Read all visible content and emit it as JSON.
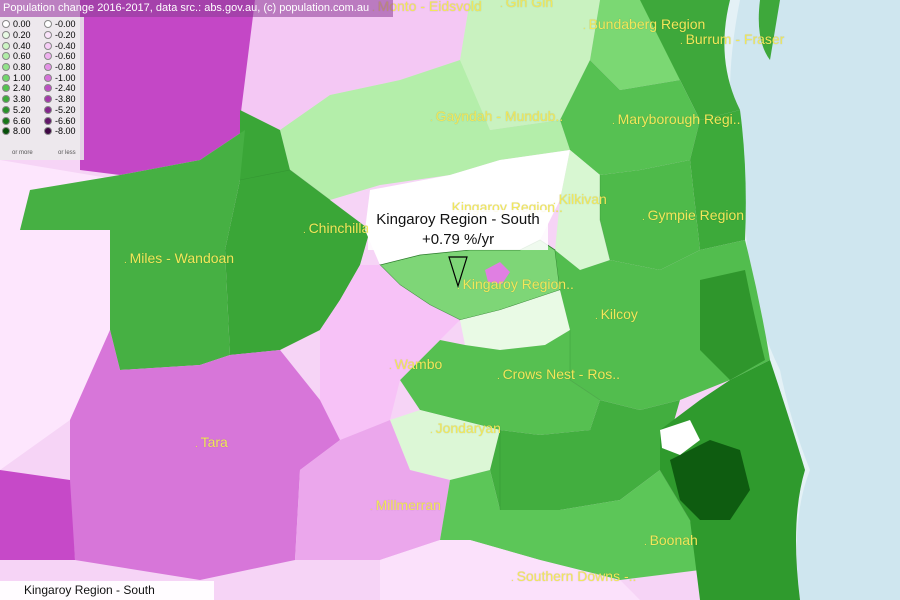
{
  "title": "Population change 2016-2017, data src.: abs.gov.au, (c) population.com.au",
  "legend": {
    "positive": [
      {
        "value": "0.00",
        "color": "#ffffff"
      },
      {
        "value": "0.20",
        "color": "#e8fbe4"
      },
      {
        "value": "0.40",
        "color": "#cdf5c4"
      },
      {
        "value": "0.60",
        "color": "#b1eda7"
      },
      {
        "value": "0.80",
        "color": "#93e38b"
      },
      {
        "value": "1.00",
        "color": "#72d66c"
      },
      {
        "value": "2.40",
        "color": "#53c24f"
      },
      {
        "value": "3.80",
        "color": "#3dab3b"
      },
      {
        "value": "5.20",
        "color": "#29922a"
      },
      {
        "value": "6.60",
        "color": "#177619"
      },
      {
        "value": "8.00",
        "color": "#064f09"
      }
    ],
    "negative": [
      {
        "value": "-0.00",
        "color": "#ffffff"
      },
      {
        "value": "-0.20",
        "color": "#fbe4fb"
      },
      {
        "value": "-0.40",
        "color": "#f6cdf6"
      },
      {
        "value": "-0.60",
        "color": "#efb1ef"
      },
      {
        "value": "-0.80",
        "color": "#e493e6"
      },
      {
        "value": "-1.00",
        "color": "#d572d8"
      },
      {
        "value": "-2.40",
        "color": "#bd50c2"
      },
      {
        "value": "-3.80",
        "color": "#a23aa8"
      },
      {
        "value": "-5.20",
        "color": "#83278a"
      },
      {
        "value": "-6.60",
        "color": "#621769"
      },
      {
        "value": "-8.00",
        "color": "#3f0844"
      }
    ],
    "pos_note": "or more",
    "neg_note": "or less"
  },
  "labels": [
    "Monto - Eidsvold",
    "Gin Gin",
    "Bundaberg Region",
    "Burrum - Fraser",
    "Gayndah - Mundub..",
    "Maryborough Regi..",
    "Kilkivan",
    "Kingaroy Region..",
    "Gympie Region",
    "Chinchilla",
    "Miles - Wandoan",
    "Kingaroy Region..",
    "Kilcoy",
    "Wambo",
    "Crows Nest - Ros..",
    "Tara",
    "Jondaryan",
    "Millmerran",
    "Boonah",
    "Southern Downs -.."
  ],
  "tooltip": {
    "name": "Kingaroy Region - South",
    "rate": "+0.79 %/yr"
  },
  "selected_region": "Kingaroy Region - South",
  "colors": {
    "ocean": "#dcecf2",
    "highlight": "#ffffff"
  }
}
